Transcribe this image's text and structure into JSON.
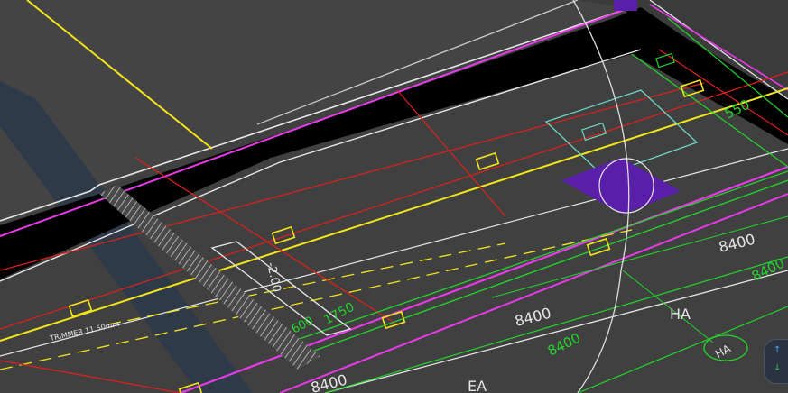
{
  "drawing": {
    "dimensions": {
      "dim_8400_a": "8400",
      "dim_8400_b": "8400",
      "dim_8400_c": "8400",
      "dim_8400_d": "8400",
      "dim_8400_e": "8400",
      "dim_550": "550",
      "dim_1750": "1750",
      "dim_600": "600"
    },
    "grid_labels": {
      "ha_text": "HA",
      "ha_bubble": "HA",
      "ea_text": "EA"
    },
    "level_text": "-2.00",
    "note_text": "TRIMMER 11.50mm"
  },
  "nav_widget": {
    "up_glyph": "↑",
    "down_glyph": "↓",
    "up_value": "1",
    "down_value": "0"
  },
  "colors": {
    "background": "#3b3b3b",
    "slab_dark": "#000000",
    "red_grid": "#e0201c",
    "yellow": "#f2e51a",
    "magenta": "#e83ae8",
    "green": "#22d42a",
    "cyan": "#6fd6c5",
    "purple": "#5a1fa8",
    "white": "#e6e6e6"
  }
}
